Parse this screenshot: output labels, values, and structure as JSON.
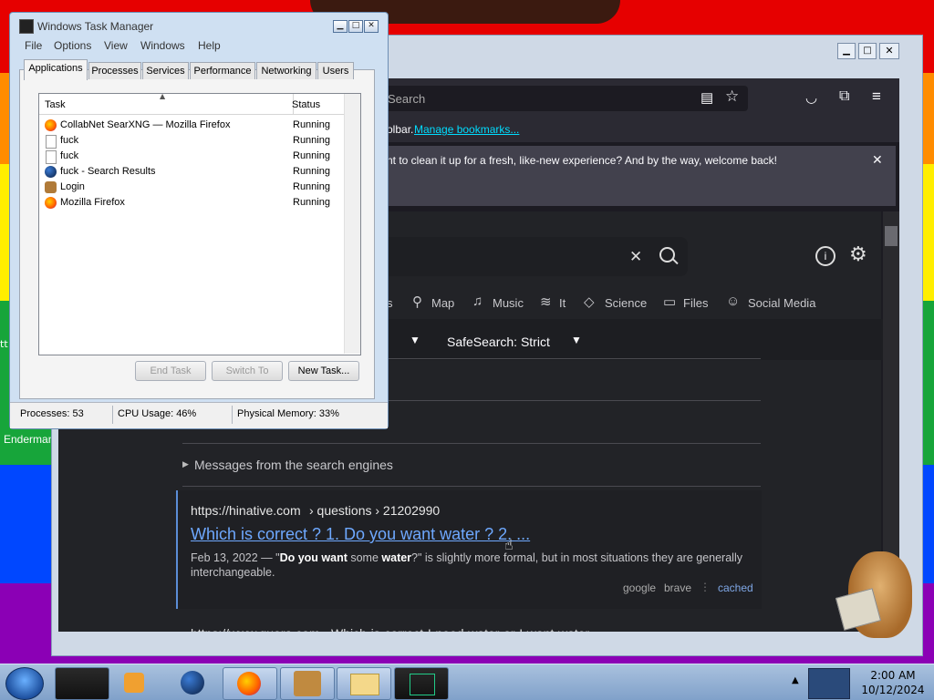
{
  "desktop": {
    "left_label": "Enderman",
    "left_label2": "tt"
  },
  "taskbar": {
    "time": "2:00 AM",
    "date": "10/12/2024"
  },
  "firefox": {
    "search_placeholder": "Search",
    "bookmarks_hint": "olbar.",
    "manage_bookmarks": "Manage bookmarks...",
    "notification": "nt to clean it up for a fresh, like-new experience? And by the way, welcome back!",
    "categories": [
      "s",
      "Map",
      "Music",
      "It",
      "Science",
      "Files",
      "Social Media"
    ],
    "safesearch": "SafeSearch: Strict",
    "engine_messages": "Messages from the search engines",
    "result": {
      "url": "https://hinative.com",
      "breadcrumb": "› questions › 21202990",
      "title": "Which is correct ?  1. Do you want water ?  2. ...",
      "date": "Feb 13, 2022",
      "snippet_pre": "\"",
      "snippet_b1": "Do you want",
      "snippet_mid1": " some ",
      "snippet_b2": "water",
      "snippet_post": "?\" is slightly more formal, but in most situations they are generally interchangeable.",
      "engines": [
        "google",
        "brave"
      ],
      "cached": "cached"
    },
    "next_result_partial": "https://www.quora.com  › Which-is-correct-I-need-water-or-I-want-water"
  },
  "task_manager": {
    "title": "Windows Task Manager",
    "menu": [
      "File",
      "Options",
      "View",
      "Windows",
      "Help"
    ],
    "tabs": [
      "Applications",
      "Processes",
      "Services",
      "Performance",
      "Networking",
      "Users"
    ],
    "columns": {
      "task": "Task",
      "status": "Status"
    },
    "rows": [
      {
        "name": "CollabNet SearXNG — Mozilla Firefox",
        "status": "Running",
        "icon": "firefox-icon"
      },
      {
        "name": "fuck",
        "status": "Running",
        "icon": "document-icon"
      },
      {
        "name": "fuck",
        "status": "Running",
        "icon": "document-icon"
      },
      {
        "name": "fuck - Search Results",
        "status": "Running",
        "icon": "globe-icon"
      },
      {
        "name": "Login",
        "status": "Running",
        "icon": "user-icon"
      },
      {
        "name": "Mozilla Firefox",
        "status": "Running",
        "icon": "firefox-icon"
      }
    ],
    "buttons": {
      "end_task": "End Task",
      "switch_to": "Switch To",
      "new_task": "New Task..."
    },
    "status_bar": {
      "processes": "Processes: 53",
      "cpu": "CPU Usage: 46%",
      "memory": "Physical Memory: 33%"
    }
  }
}
